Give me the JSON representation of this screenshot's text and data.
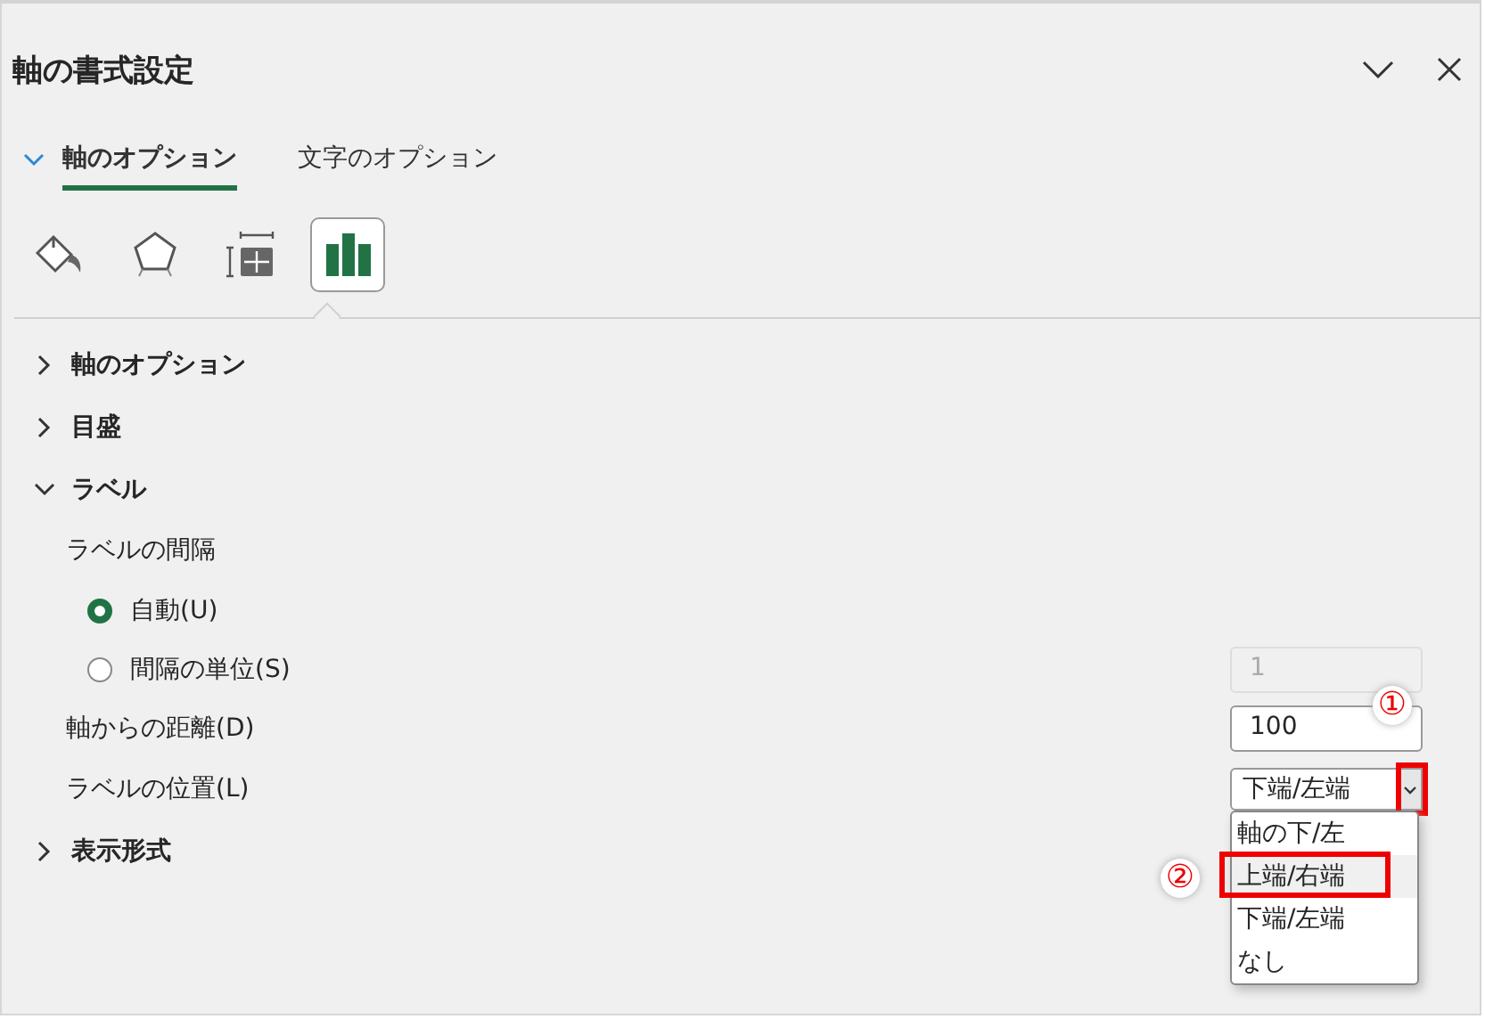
{
  "panel": {
    "title": "軸の書式設定"
  },
  "tabs": [
    {
      "label": "軸のオプション",
      "selected": true
    },
    {
      "label": "文字のオプション",
      "selected": false
    }
  ],
  "icon_tabs": [
    {
      "kind": "fill",
      "selected": false
    },
    {
      "kind": "effects",
      "selected": false
    },
    {
      "kind": "size",
      "selected": false
    },
    {
      "kind": "options",
      "selected": true
    }
  ],
  "sections": [
    {
      "title": "軸のオプション",
      "expanded": false
    },
    {
      "title": "目盛",
      "expanded": false
    },
    {
      "title": "ラベル",
      "expanded": true,
      "body": {
        "interval_label": "ラベルの間隔",
        "radios": [
          {
            "label": "自動(U)",
            "selected": true
          },
          {
            "label": "間隔の単位(S)",
            "selected": false
          }
        ],
        "interval_value": {
          "value": "1",
          "disabled": true
        },
        "distance": {
          "label": "軸からの距離(D)",
          "value": "100"
        },
        "position": {
          "label": "ラベルの位置(L)",
          "value": "下端/左端",
          "open": true,
          "options": [
            {
              "label": "軸の下/左",
              "highlighted": false
            },
            {
              "label": "上端/右端",
              "highlighted": true
            },
            {
              "label": "下端/左端",
              "highlighted": false
            },
            {
              "label": "なし",
              "highlighted": false
            }
          ]
        }
      }
    },
    {
      "title": "表示形式",
      "expanded": false
    }
  ],
  "annotations": [
    {
      "kind": "button",
      "label": "①"
    },
    {
      "kind": "option",
      "label": "②"
    }
  ]
}
